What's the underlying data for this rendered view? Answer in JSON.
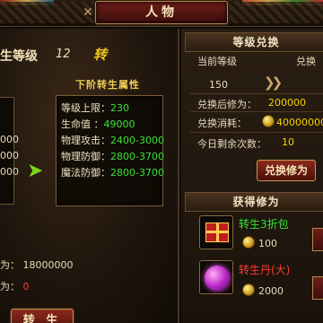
{
  "title": "人物",
  "rebirth": {
    "label": "生等级",
    "level": "12",
    "unit": "转"
  },
  "current_values": [
    "000",
    "000",
    "000"
  ],
  "next_section": {
    "title": "下阶转生属性",
    "rows": [
      {
        "label": "等级上限：",
        "value": "230"
      },
      {
        "label": "生命值 ：",
        "value": "49000"
      },
      {
        "label": "物理攻击：",
        "value": "2400-3000"
      },
      {
        "label": "物理防御：",
        "value": "2800-3700"
      },
      {
        "label": "魔法防御：",
        "value": "2800-3700"
      }
    ]
  },
  "cost": {
    "label": "为：",
    "value": "18000000"
  },
  "have": {
    "label": "为：",
    "value": "0"
  },
  "rebirth_button": "转 生",
  "exchange": {
    "title": "等级兑换",
    "current_level_label": "当前等级",
    "exchange_label": "兑换",
    "current_level": "150",
    "after_label": "兑换后修为：",
    "after_value": "200000",
    "consume_label": "兑换消耗：",
    "consume_value": "40000000",
    "remaining_label": "今日剩余次数：",
    "remaining_value": "10",
    "button": "兑换修为"
  },
  "gain": {
    "title": "获得修为",
    "items": [
      {
        "name": "转生3折包",
        "price": "100",
        "color": "#33e33a"
      },
      {
        "name": "转生丹(大)",
        "price": "2000",
        "color": "#ff3b2f"
      }
    ]
  },
  "icons": [
    "close-icon",
    "green-arrow-icon",
    "double-arrow-icon",
    "gold-coin-icon",
    "gift-box-icon",
    "purple-orb-icon"
  ]
}
